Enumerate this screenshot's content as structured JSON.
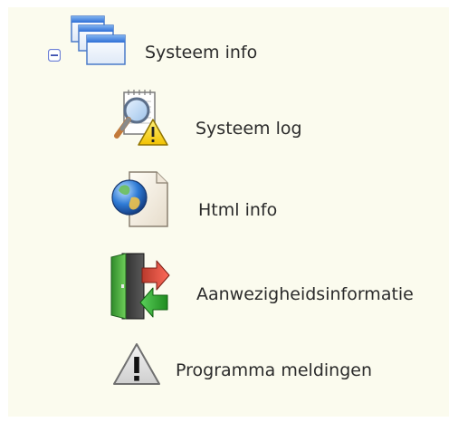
{
  "tree": {
    "root": {
      "label": "Systeem info",
      "icon": "windows-stack-icon",
      "expanded": true,
      "toggle_icon": "collapse-minus-icon"
    },
    "children": [
      {
        "label": "Systeem log",
        "icon": "log-magnifier-warning-icon"
      },
      {
        "label": "Html info",
        "icon": "globe-document-icon"
      },
      {
        "label": "Aanwezigheidsinformatie",
        "icon": "door-in-out-arrows-icon"
      },
      {
        "label": "Programma meldingen",
        "icon": "warning-triangle-icon"
      }
    ]
  },
  "colors": {
    "panel_background": "#fbfbee",
    "text": "#2b2b2b",
    "toggle_border": "#6b7fd6"
  }
}
